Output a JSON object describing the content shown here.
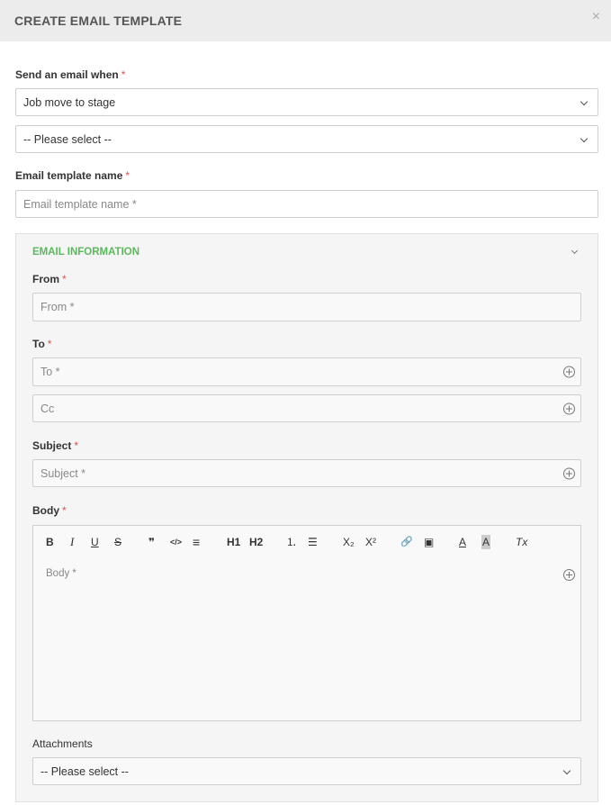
{
  "modal": {
    "title": "CREATE EMAIL TEMPLATE",
    "close": "×"
  },
  "trigger": {
    "label": "Send an email when",
    "required": "*",
    "event_value": "Job move to stage",
    "stage_value": "-- Please select --"
  },
  "template_name": {
    "label": "Email template name",
    "required": "*",
    "placeholder": "Email template name *"
  },
  "email_info": {
    "title": "EMAIL INFORMATION",
    "from": {
      "label": "From",
      "required": "*",
      "placeholder": "From *"
    },
    "to": {
      "label": "To",
      "required": "*",
      "placeholder": "To *"
    },
    "cc": {
      "placeholder": "Cc"
    },
    "subject": {
      "label": "Subject",
      "required": "*",
      "placeholder": "Subject *"
    },
    "body": {
      "label": "Body",
      "required": "*",
      "placeholder": "Body *"
    },
    "attachments": {
      "label": "Attachments",
      "value": "-- Please select --"
    }
  },
  "toolbar": {
    "bold": "B",
    "italic": "I",
    "underline": "U",
    "strike": "S",
    "quote": "❞",
    "code": "</>",
    "align": "≡",
    "h1": "H1",
    "h2": "H2",
    "ordered_list": "⒈",
    "bullet_list": "☰",
    "subscript": "X₂",
    "superscript": "X²",
    "link": "🔗",
    "image": "▣",
    "font_color": "A",
    "bg_color": "A",
    "clear_format": "Tx"
  }
}
